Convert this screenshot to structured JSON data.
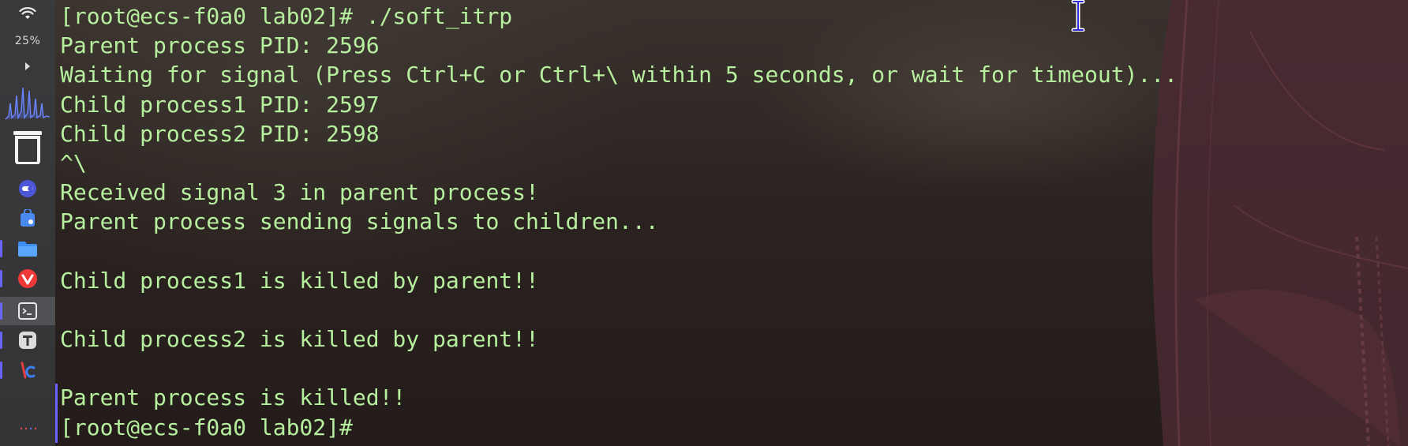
{
  "dock": {
    "battery_label": "25%",
    "items": [
      {
        "name": "wifi-icon"
      },
      {
        "name": "battery-status"
      },
      {
        "name": "expand-arrow-icon"
      },
      {
        "name": "cpu-graph"
      },
      {
        "name": "trash-icon"
      },
      {
        "name": "toggle-app-icon"
      },
      {
        "name": "store-app-icon"
      },
      {
        "name": "files-app-icon"
      },
      {
        "name": "vivaldi-app-icon"
      },
      {
        "name": "terminal-app-icon"
      },
      {
        "name": "text-editor-app-icon"
      },
      {
        "name": "ide-app-icon"
      }
    ]
  },
  "terminal": {
    "lines": [
      "[root@ecs-f0a0 lab02]# ./soft_itrp",
      "Parent process PID: 2596",
      "Waiting for signal (Press Ctrl+C or Ctrl+\\ within 5 seconds, or wait for timeout)...",
      "Child process1 PID: 2597",
      "Child process2 PID: 2598",
      "^\\",
      "Received signal 3 in parent process!",
      "Parent process sending signals to children...",
      "",
      "Child process1 is killed by parent!!",
      "",
      "Child process2 is killed by parent!!",
      "",
      "Parent process is killed!!",
      "[root@ecs-f0a0 lab02]#"
    ],
    "text_color": "#b6ef9e",
    "accent_color": "#6b63ff"
  }
}
